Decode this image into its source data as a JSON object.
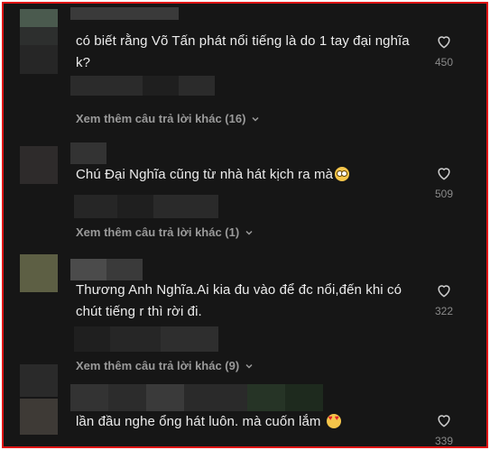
{
  "comments": [
    {
      "text": "có biết rằng Võ Tấn phát nổi tiếng là do 1 tay đại nghĩa k?",
      "emoji": "",
      "likes": "450",
      "replies": "Xem thêm câu trả lời khác (16)"
    },
    {
      "text": "Chú Đại Nghĩa cũng từ nhà hát kịch ra mà",
      "emoji": "flushed-face-emoji",
      "likes": "509",
      "replies": "Xem thêm câu trả lời khác (1)"
    },
    {
      "text": "Thương Anh Nghĩa.Ai kia đu vào để đc nổi,đến khi có chút tiếng r thì rời đi.",
      "emoji": "",
      "likes": "322",
      "replies": "Xem thêm câu trả lời khác (9)"
    },
    {
      "text": "lần đầu nghe ổng hát luôn. mà cuốn lắm",
      "emoji": "heart-eyes-emoji",
      "likes": "339",
      "replies": ""
    }
  ],
  "colors": {
    "border": "#e01515",
    "background": "#161616",
    "text": "#ececec",
    "muted": "#9a9a9a"
  }
}
